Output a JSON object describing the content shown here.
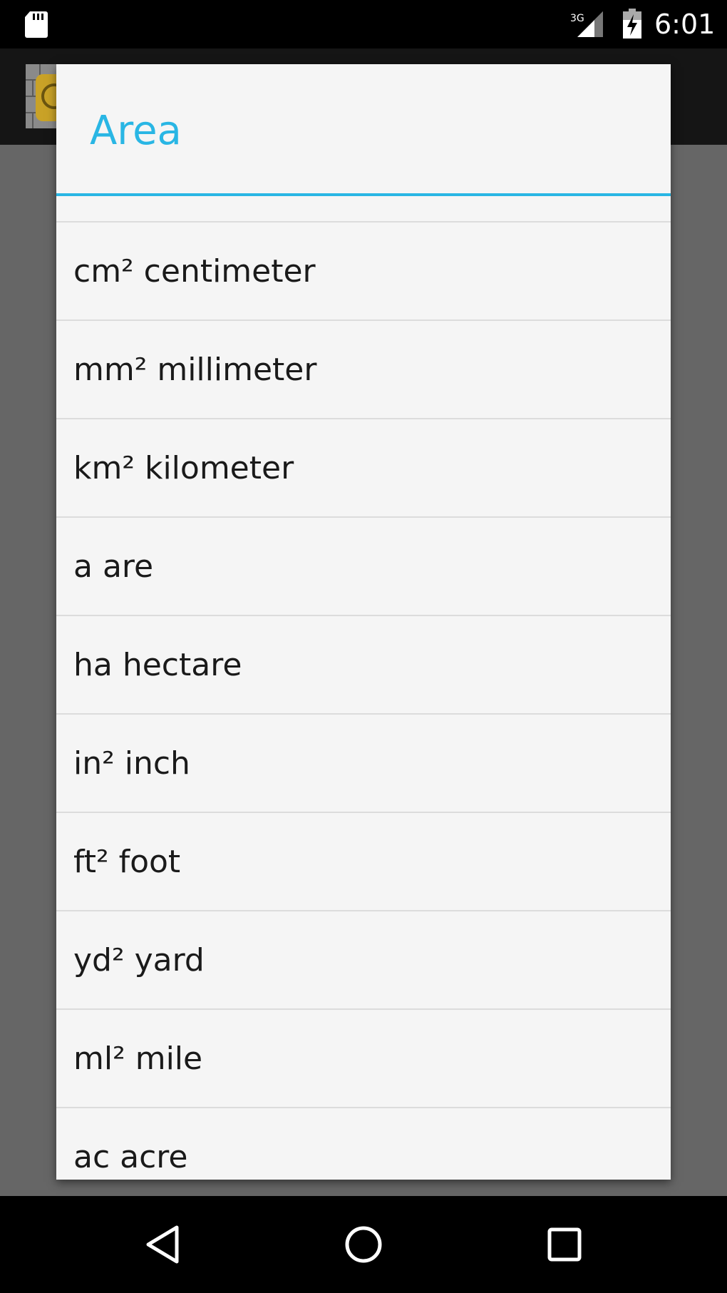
{
  "status_bar": {
    "time": "6:01",
    "network": "3G",
    "icons": [
      "sd-card-icon",
      "signal-3g-icon",
      "battery-charging-icon"
    ]
  },
  "dialog": {
    "title": "Area",
    "accent_color": "#29b6e4",
    "items": [
      {
        "label": "cm² centimeter"
      },
      {
        "label": "mm² millimeter"
      },
      {
        "label": "km² kilometer"
      },
      {
        "label": "a are"
      },
      {
        "label": "ha hectare"
      },
      {
        "label": "in² inch"
      },
      {
        "label": "ft² foot"
      },
      {
        "label": "yd² yard"
      },
      {
        "label": "ml² mile"
      },
      {
        "label": "ac acre"
      }
    ]
  },
  "nav_bar": {
    "buttons": [
      "back-icon",
      "home-icon",
      "recents-icon"
    ]
  }
}
